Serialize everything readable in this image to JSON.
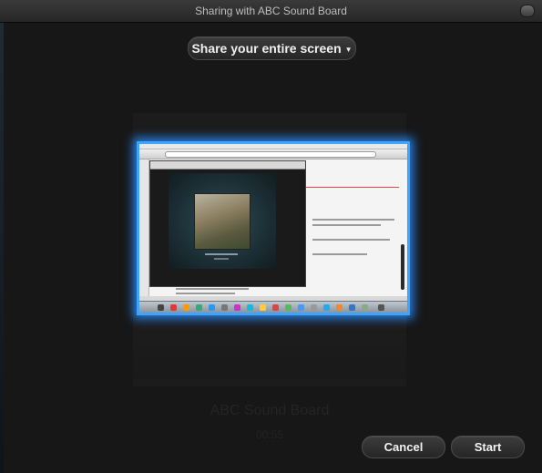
{
  "window": {
    "title": "Sharing with ABC Sound Board"
  },
  "share_mode": {
    "label": "Share your entire screen",
    "icon": "chevron-down-icon"
  },
  "background_card": {
    "title": "ABC Sound Board",
    "time": "00:55"
  },
  "actions": {
    "cancel_label": "Cancel",
    "start_label": "Start"
  },
  "colors": {
    "selection_glow": "#3da4ff",
    "window_bg": "#171717"
  }
}
